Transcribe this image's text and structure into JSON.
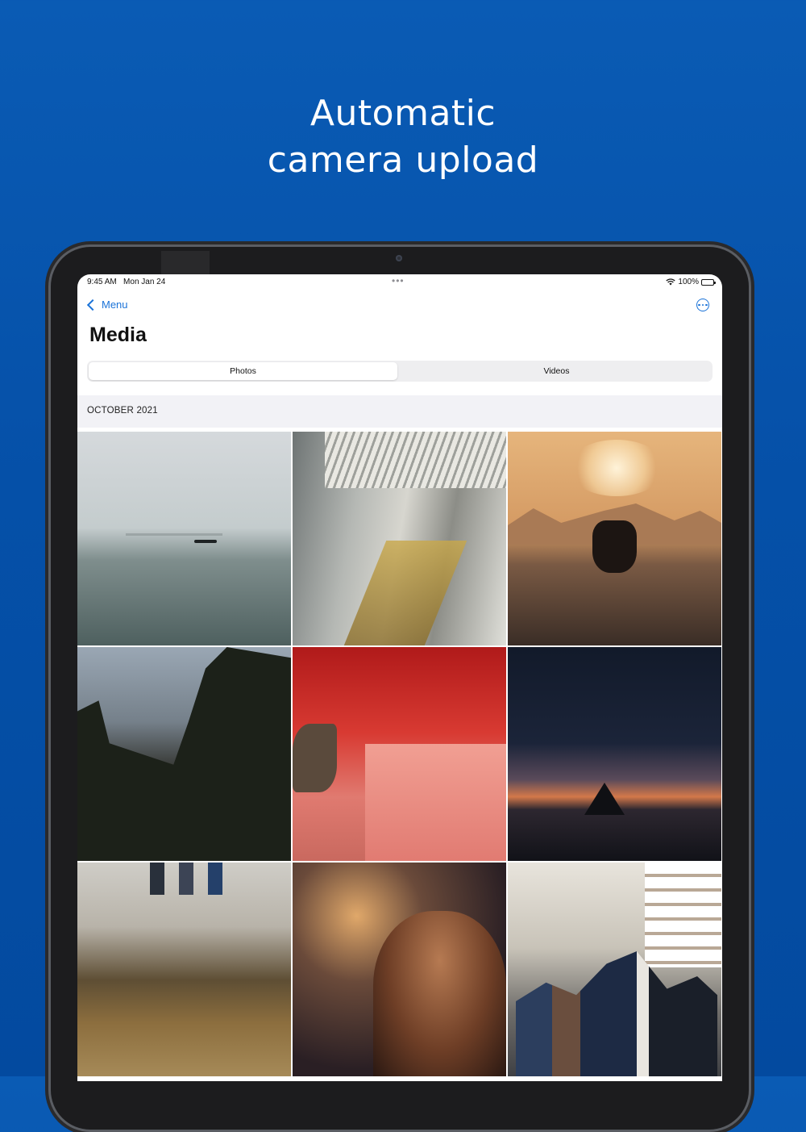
{
  "headline": {
    "line1": "Automatic",
    "line2": "camera upload"
  },
  "status_bar": {
    "time": "9:45 AM",
    "date": "Mon Jan 24",
    "dots": "•••",
    "battery": "100%"
  },
  "nav": {
    "back_label": "Menu",
    "title": "Media"
  },
  "segmented": {
    "photos": "Photos",
    "videos": "Videos",
    "selected": "Photos"
  },
  "section": {
    "header": "OCTOBER 2021"
  },
  "colors": {
    "background": "#0550a8",
    "accent": "#1b73d8"
  },
  "icons": {
    "back": "chevron-left-icon",
    "more": "ellipsis-circle-icon",
    "wifi": "wifi-icon",
    "battery": "battery-icon"
  }
}
